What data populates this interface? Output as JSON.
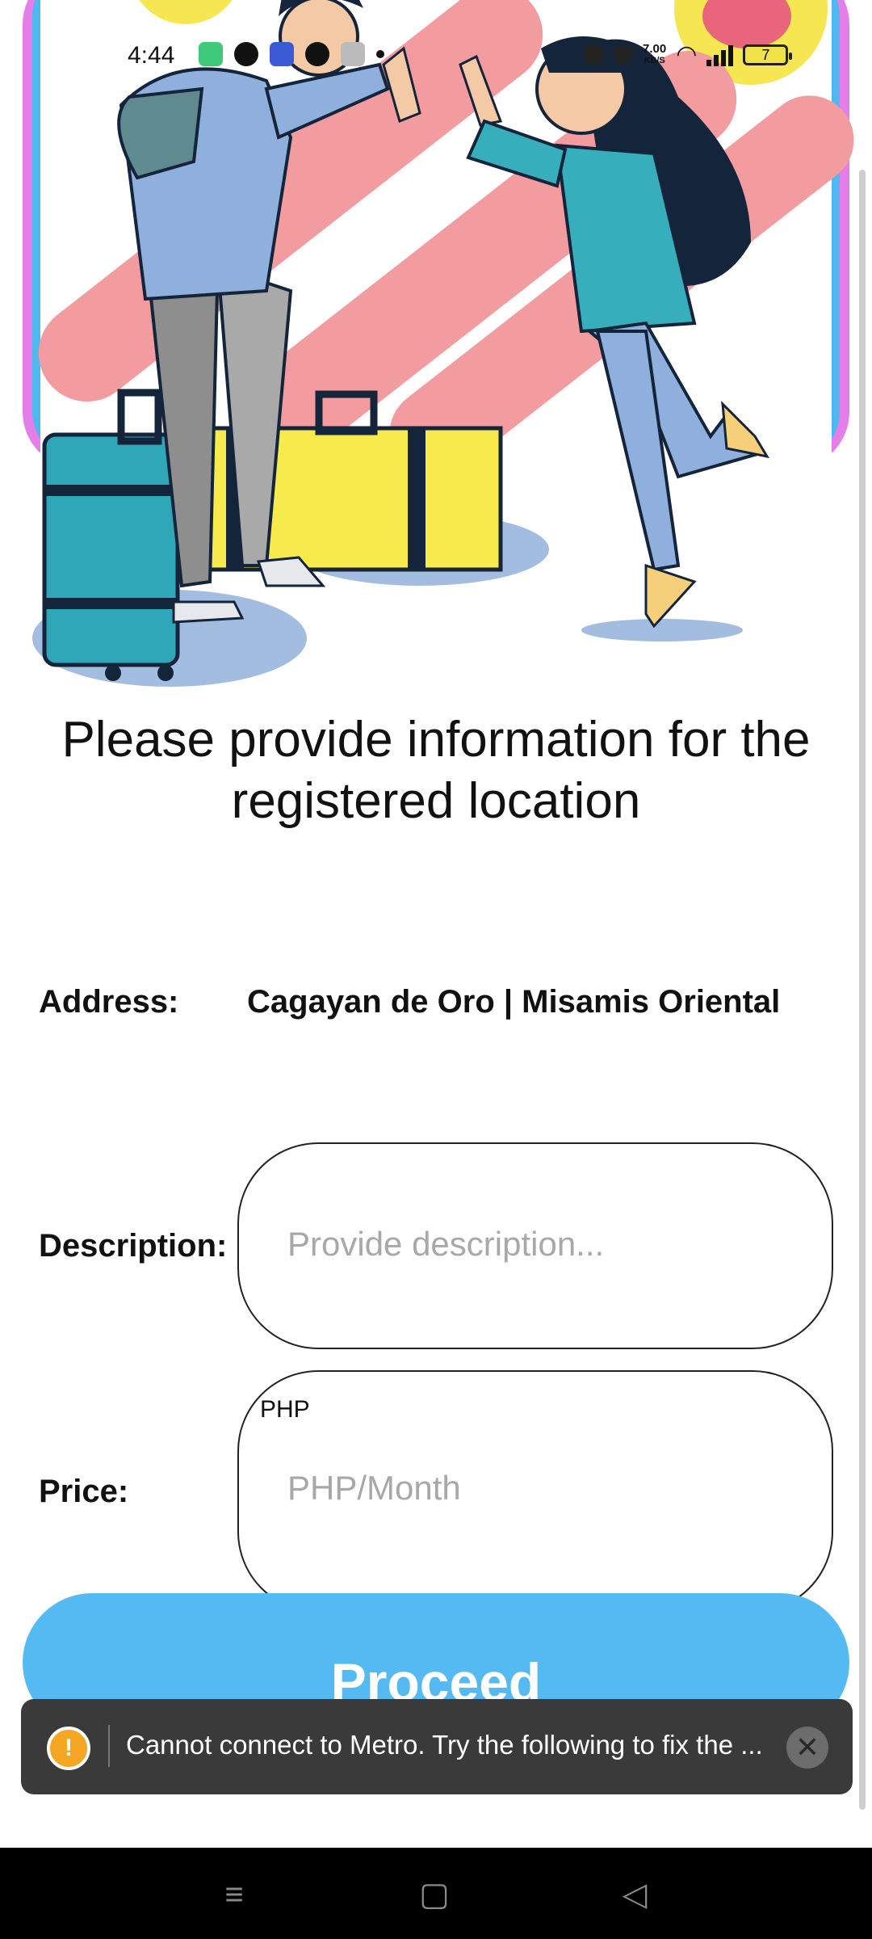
{
  "status_bar": {
    "time": "4:44",
    "speed_value": "7.00",
    "speed_unit": "KB/S",
    "battery": "7",
    "left_icons": [
      "app-icon",
      "messenger-icon",
      "app-icon",
      "app-icon",
      "gmail-icon",
      "dot-icon"
    ],
    "right_icons": [
      "alarm-icon",
      "mute-icon",
      "wifi-icon",
      "signal-icon",
      "battery-icon"
    ]
  },
  "heading": "Please provide information for the registered location",
  "form": {
    "address_label": "Address:",
    "address_value": "Cagayan de Oro | Misamis Oriental",
    "description_label": "Description:",
    "description_placeholder": "Provide description...",
    "price_label": "Price:",
    "price_prefix": "PHP",
    "price_placeholder": "PHP/Month"
  },
  "proceed_label": "Proceed",
  "toast": {
    "message": "Cannot connect to Metro.  Try the following to fix the ...",
    "warning_icon": "!",
    "close_icon": "✕"
  },
  "nav": {
    "menu_icon": "≡",
    "home_icon": "▢",
    "back_icon": "◁"
  },
  "colors": {
    "primary": "#56baf2",
    "toast_bg": "#3a3a3a",
    "warning": "#f5a623"
  }
}
